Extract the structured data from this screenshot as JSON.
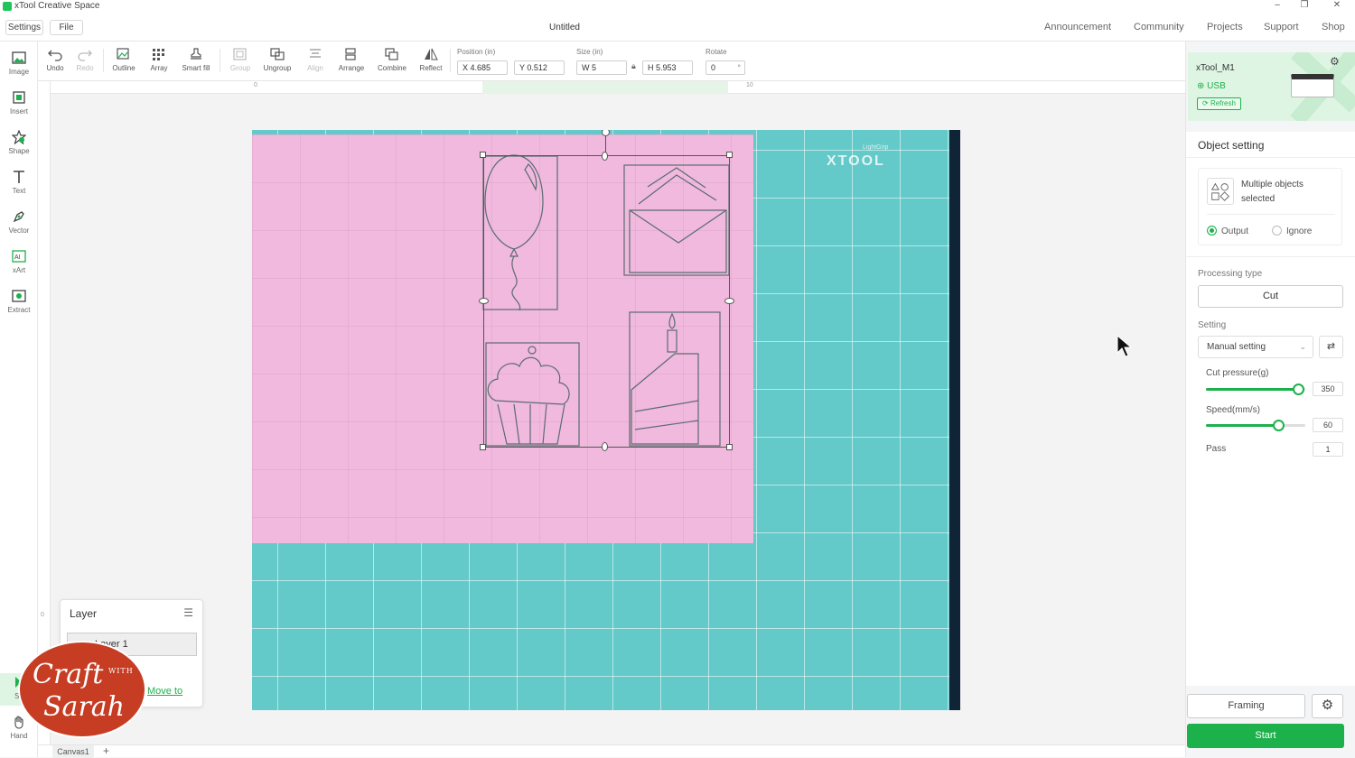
{
  "app": {
    "title": "xTool Creative Space",
    "document_title": "Untitled",
    "window_buttons": [
      "–",
      "❐",
      "✕"
    ]
  },
  "menubar": {
    "settings_label": "Settings",
    "file_label": "File",
    "nav": [
      "Announcement",
      "Community",
      "Projects",
      "Support",
      "Shop"
    ]
  },
  "left_tools": [
    "Image",
    "Insert",
    "Shape",
    "Text",
    "Vector",
    "xArt",
    "Extract",
    "Se",
    "Hand"
  ],
  "toolbar": {
    "undo": "Undo",
    "redo": "Redo",
    "outline": "Outline",
    "array": "Array",
    "smart_fill": "Smart fill",
    "group": "Group",
    "ungroup": "Ungroup",
    "align": "Align",
    "arrange": "Arrange",
    "combine": "Combine",
    "reflect": "Reflect",
    "position_label": "Position (in)",
    "pos_x": "X 4.685",
    "pos_y": "Y 0.512",
    "size_label": "Size (in)",
    "width": "W 5",
    "height": "H 5.953",
    "rotate_label": "Rotate",
    "rotate": "0",
    "rotate_unit": "°"
  },
  "ruler": {
    "top": [
      "0",
      "10"
    ],
    "left": [
      "0"
    ]
  },
  "mat": {
    "brand": "XTOOL",
    "sub": "LightGrip"
  },
  "layer_panel": {
    "title": "Layer",
    "item": "Layer 1",
    "move_to": "Move to"
  },
  "logo": {
    "line1": "Craft",
    "with": "WITH",
    "line2": "Sarah"
  },
  "canvas_tab": "Canvas1",
  "canvas_add": "+",
  "device": {
    "name": "xTool_M1",
    "connection": "USB",
    "refresh": "Refresh"
  },
  "object_setting": {
    "title": "Object setting",
    "selected_text": "Multiple objects selected",
    "output": "Output",
    "ignore": "Ignore",
    "selected_mode": "Output",
    "processing_type_label": "Processing type",
    "processing_type": "Cut",
    "setting_label": "Setting",
    "setting_value": "Manual setting",
    "cut_pressure_label": "Cut pressure(g)",
    "cut_pressure": "350",
    "cut_pressure_fraction": 0.93,
    "speed_label": "Speed(mm/s)",
    "speed": "60",
    "speed_fraction": 0.73,
    "pass_label": "Pass",
    "pass": "1"
  },
  "actions": {
    "framing": "Framing",
    "start": "Start"
  },
  "colors": {
    "accent": "#1db14b",
    "mat": "#64c9c9",
    "paper": "#f0b9dd"
  }
}
